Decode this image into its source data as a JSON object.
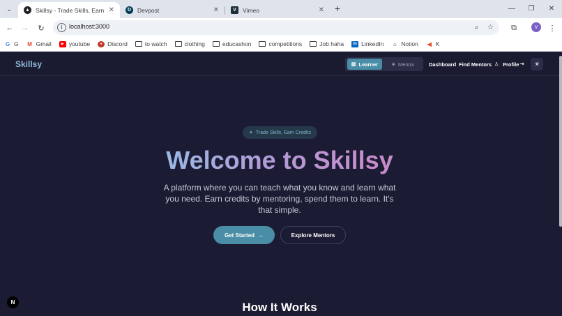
{
  "browser": {
    "tabs": [
      {
        "title": "Skillsy - Trade Skills, Earn Credits",
        "active": true
      },
      {
        "title": "Devpost",
        "active": false
      },
      {
        "title": "Vimeo",
        "active": false
      }
    ],
    "url": "localhost:3000",
    "profile_initial": "V",
    "bookmarks": [
      {
        "label": "G",
        "icon": "google-icon"
      },
      {
        "label": "Gmail",
        "icon": "gmail-icon"
      },
      {
        "label": "youtube",
        "icon": "youtube-icon"
      },
      {
        "label": "Discord",
        "icon": "discord-icon"
      },
      {
        "label": "to watch",
        "icon": "folder-icon"
      },
      {
        "label": "clothing",
        "icon": "folder-icon"
      },
      {
        "label": "educashon",
        "icon": "folder-icon"
      },
      {
        "label": "competitions",
        "icon": "folder-icon"
      },
      {
        "label": "Job haha",
        "icon": "folder-icon"
      },
      {
        "label": "LinkedIn",
        "icon": "linkedin-icon"
      },
      {
        "label": "Notion",
        "icon": "notion-icon"
      },
      {
        "label": "K",
        "icon": "k-icon"
      }
    ]
  },
  "app": {
    "brand": "Skillsy",
    "role_toggle": {
      "learner": "Learner",
      "mentor": "Mentor",
      "selected": "Learner"
    },
    "nav": {
      "dashboard": "Dashboard",
      "find_mentors": "Find Mentors",
      "profile": "Profile"
    },
    "hero": {
      "badge": "Trade Skills, Earn Credits",
      "title": "Welcome to Skillsy",
      "subtitle": "A platform where you can teach what you know and learn what you need. Earn credits by mentoring, spend them to learn. It's that simple.",
      "primary_cta": "Get Started",
      "secondary_cta": "Explore Mentors"
    },
    "section_title": "How It Works",
    "dev_badge": "N"
  },
  "colors": {
    "background": "#1b1c33",
    "accent": "#4a8da6",
    "brand": "#8fb8d6",
    "title_gradient": [
      "#9ab8e4",
      "#b499d6",
      "#c889c9"
    ]
  }
}
